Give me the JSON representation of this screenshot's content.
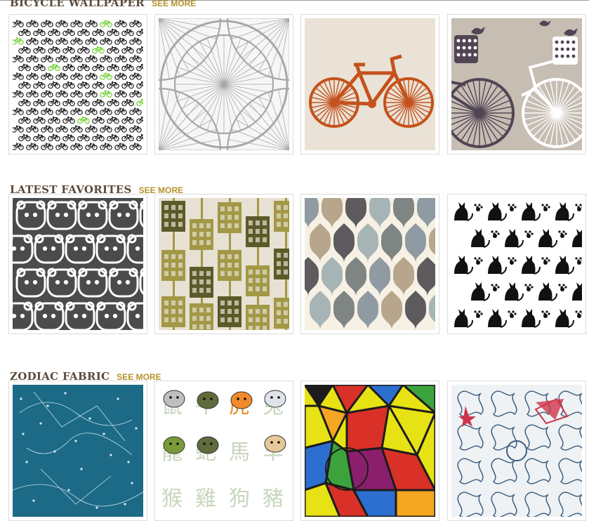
{
  "sections": [
    {
      "title": "BICYCLE WALLPAPER",
      "see_more": "SEE MORE",
      "tiles": [
        {
          "pattern": "green-bicycles-repeat",
          "colors": [
            "#ffffff",
            "#1a1a1a",
            "#6ccf2a"
          ]
        },
        {
          "pattern": "grey-bicycle-wheels",
          "colors": [
            "#f6f6f6",
            "#9a9a9a"
          ]
        },
        {
          "pattern": "orange-bicycle-vintage",
          "colors": [
            "#efe9de",
            "#c4521c"
          ]
        },
        {
          "pattern": "bicycles-with-birds",
          "colors": [
            "#c6bdb3",
            "#514554",
            "#ffffff"
          ]
        }
      ]
    },
    {
      "title": "LATEST FAVORITES",
      "see_more": "SEE MORE",
      "tiles": [
        {
          "pattern": "white-bear-faces",
          "colors": [
            "#4b4b4b",
            "#ffffff"
          ]
        },
        {
          "pattern": "olive-buildings",
          "colors": [
            "#e6e1d2",
            "#a29846",
            "#5d5a2a"
          ]
        },
        {
          "pattern": "ogee-moroccan-tiles",
          "colors": [
            "#f6f1e4",
            "#8f9aa3",
            "#b7a68c",
            "#5d5b5e",
            "#a6b4b6",
            "#7e8583"
          ]
        },
        {
          "pattern": "black-cat-damask",
          "colors": [
            "#ffffff",
            "#111111"
          ]
        }
      ]
    },
    {
      "title": "ZODIAC FABRIC",
      "see_more": "SEE MORE",
      "tiles": [
        {
          "pattern": "teal-constellations",
          "colors": [
            "#1c6a86",
            "#d8ecf2"
          ]
        },
        {
          "pattern": "chinese-zodiac-animals",
          "colors": [
            "#ffffff",
            "#5f6b3c",
            "#f08a2a",
            "#c8d6bd"
          ]
        },
        {
          "pattern": "stained-glass-gems",
          "colors": [
            "#e7e213",
            "#d93127",
            "#2d6fd0",
            "#1c1c1c",
            "#3ca33c"
          ]
        },
        {
          "pattern": "blue-red-damask",
          "colors": [
            "#eef2f4",
            "#3e5e80",
            "#d0344a"
          ]
        }
      ]
    }
  ]
}
